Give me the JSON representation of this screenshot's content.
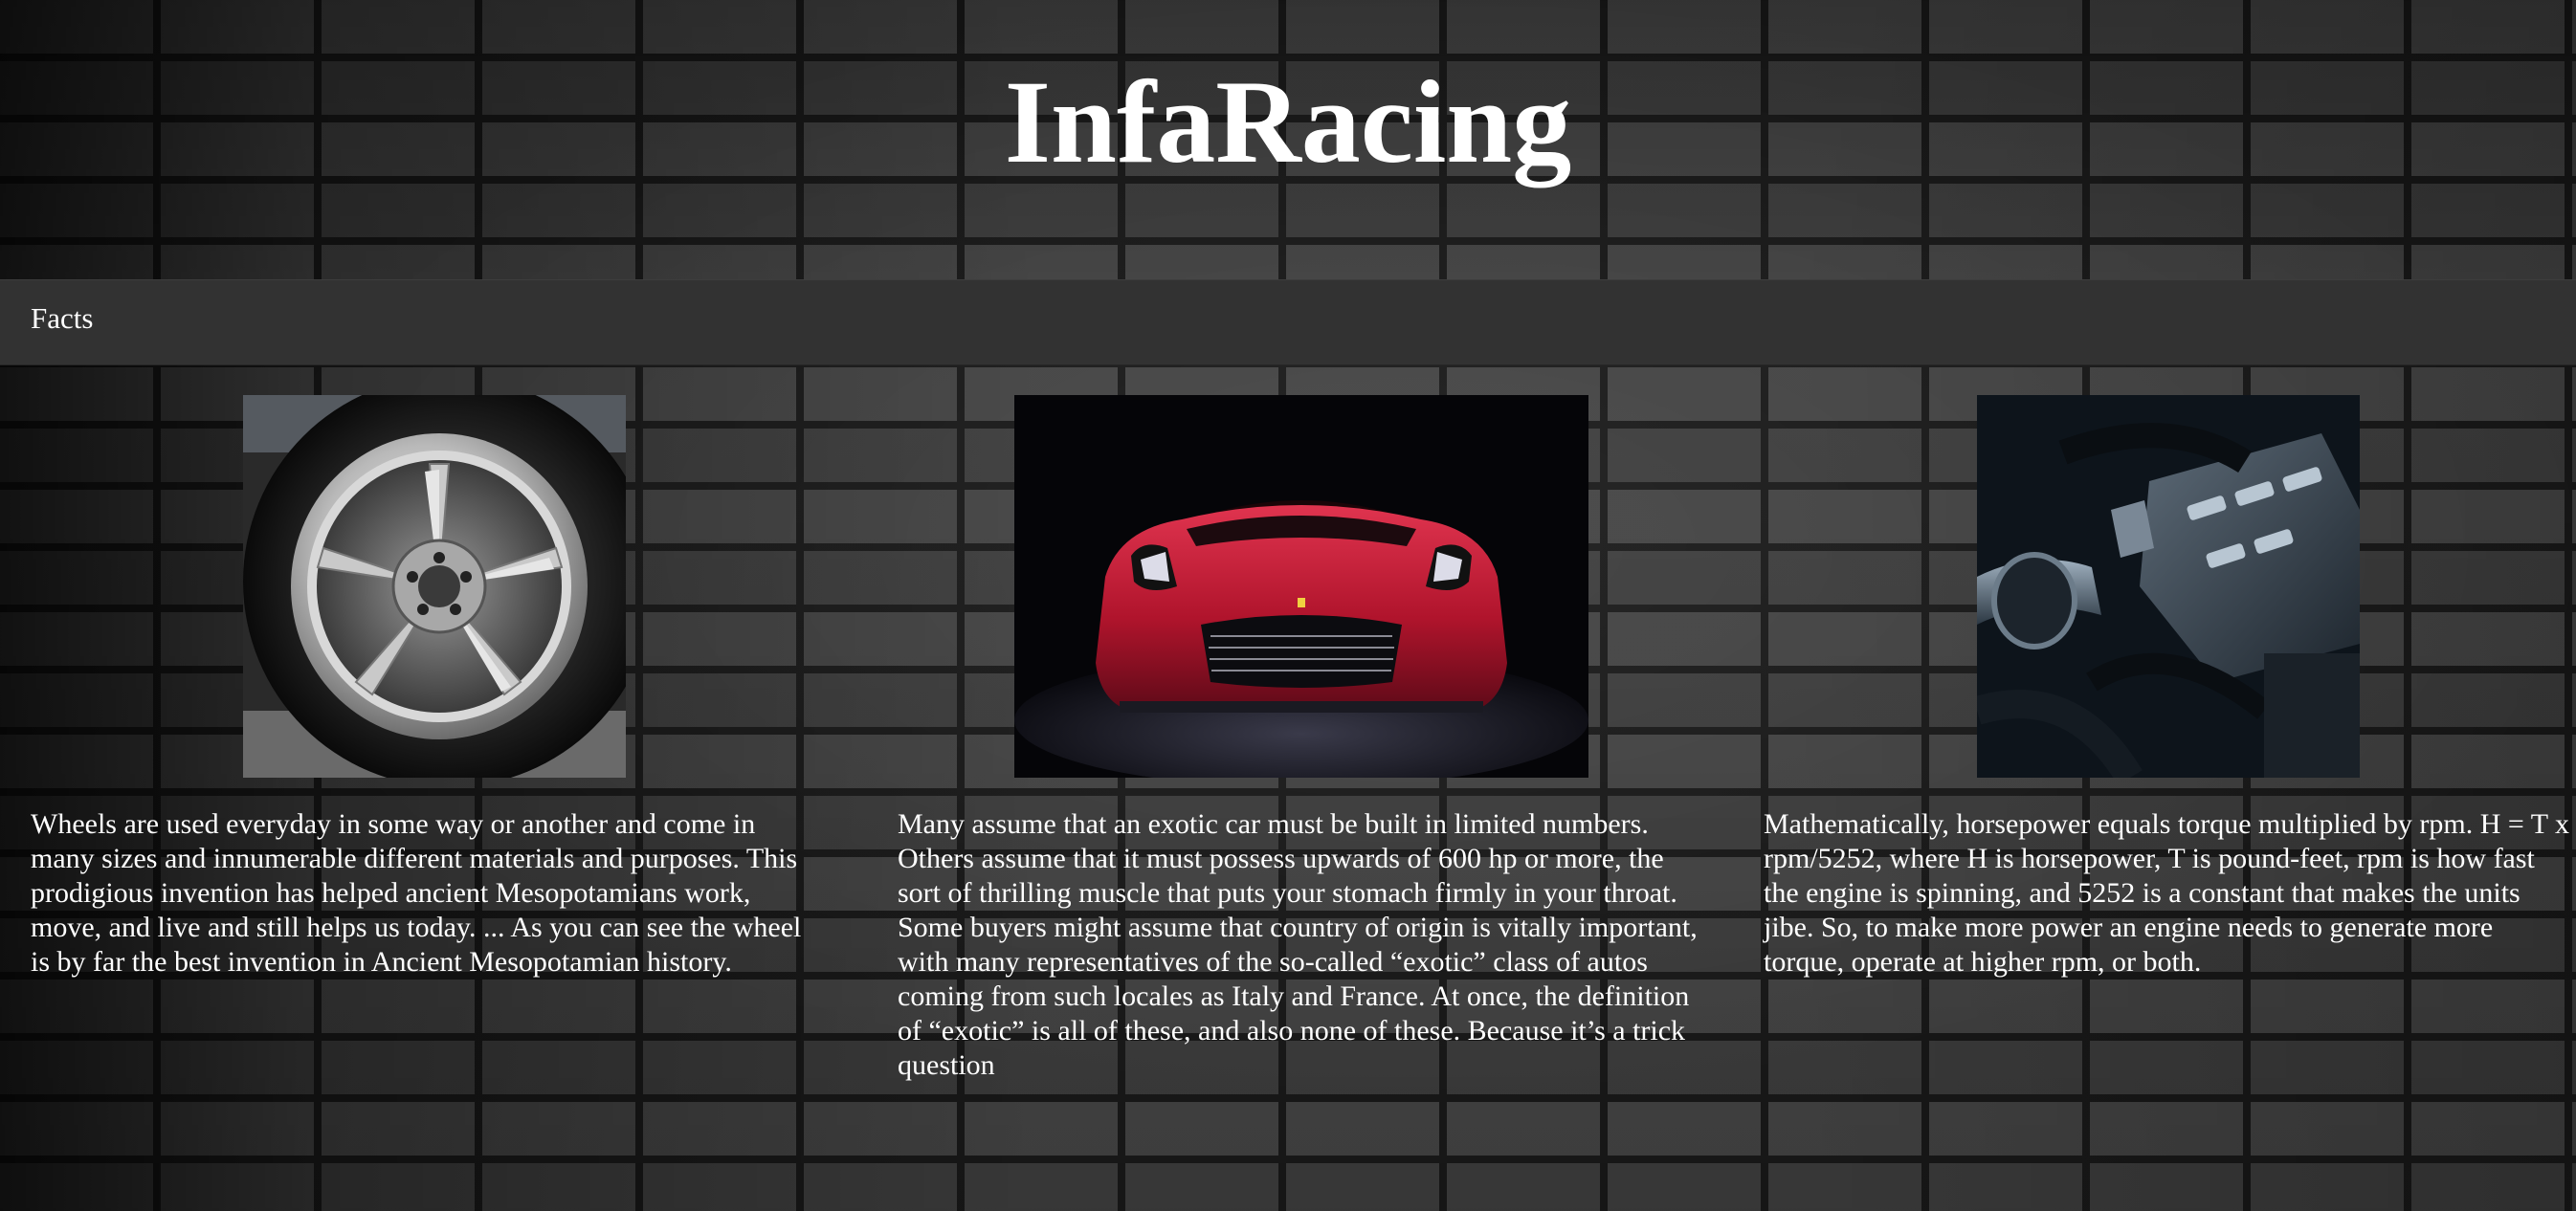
{
  "header": {
    "title": "InfaRacing"
  },
  "nav": {
    "items": [
      {
        "label": "Facts"
      }
    ]
  },
  "cards": [
    {
      "image": "car-wheel-image",
      "text": "Wheels are used everyday in some way or another and come in many sizes and innumerable different materials and purposes. This prodigious invention has helped ancient Mesopotamians work, move, and live and still helps us today. ... As you can see the wheel is by far the best invention in Ancient Mesopotamian history."
    },
    {
      "image": "red-sports-car-image",
      "text": "Many assume that an exotic car must be built in limited numbers. Others assume that it must possess upwards of 600 hp or more, the sort of thrilling muscle that puts your stomach firmly in your throat. Some buyers might assume that country of origin is vitally important, with many representatives of the so-called “exotic” class of autos coming from such locales as Italy and France. At once, the definition of “exotic” is all of these, and also none of these. Because it’s a trick question"
    },
    {
      "image": "engine-bay-image",
      "text": "Mathematically, horsepower equals torque multiplied by rpm. H = T x rpm/5252, where H is horsepower, T is pound-feet, rpm is how fast the engine is spinning, and 5252 is a constant that makes the units jibe. So, to make more power an engine needs to generate more torque, operate at higher rpm, or both."
    }
  ],
  "colors": {
    "navbar": "#323232",
    "text": "#ffffff",
    "car_red": "#c8102e"
  }
}
